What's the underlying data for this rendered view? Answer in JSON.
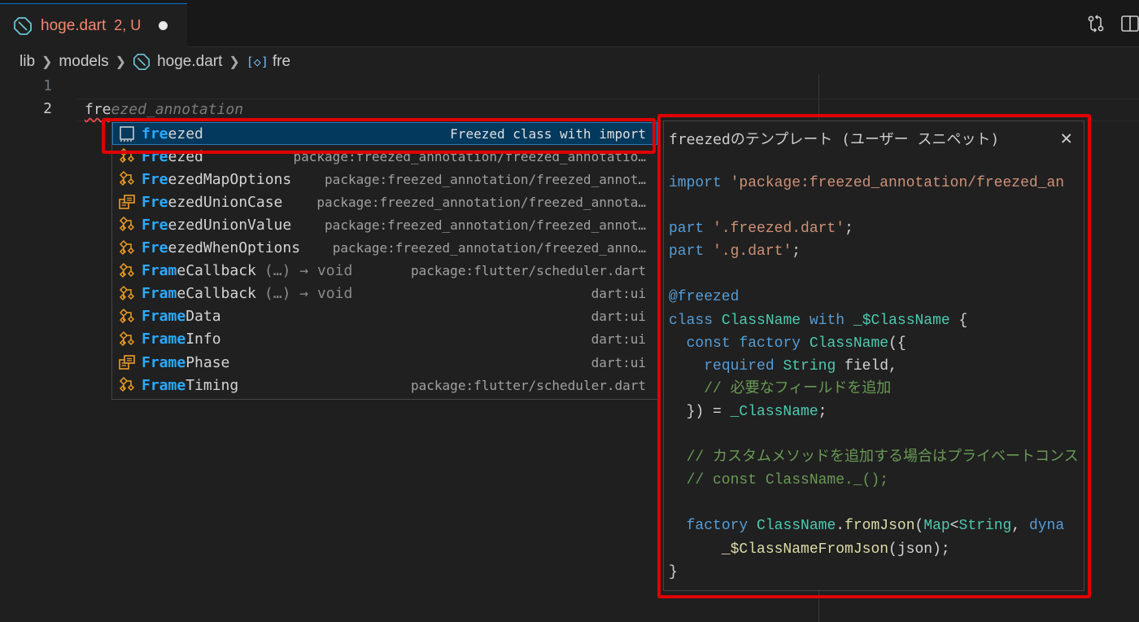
{
  "tab": {
    "file_name": "hoge.dart",
    "status": "2, U"
  },
  "breadcrumb": {
    "folder1": "lib",
    "folder2": "models",
    "file": "hoge.dart",
    "symbol": "fre"
  },
  "editor": {
    "line_numbers": [
      "1",
      "2"
    ],
    "typed_text": "fre",
    "ghost_text": "ezed_annotation"
  },
  "suggestions": [
    {
      "icon": "snippet-icon",
      "match": "fre",
      "rest": "ezed",
      "signature": "",
      "detail": "Freezed class with import",
      "selected": true
    },
    {
      "icon": "class-icon",
      "match": "Fre",
      "rest": "ezed",
      "signature": "",
      "detail": "package:freezed_annotation/freezed_annotatio…"
    },
    {
      "icon": "class-icon",
      "match": "Fre",
      "rest": "ezedMapOptions",
      "signature": "",
      "detail": "package:freezed_annotation/freezed_annot…"
    },
    {
      "icon": "enum-icon",
      "match": "Fre",
      "rest": "ezedUnionCase",
      "signature": "",
      "detail": "package:freezed_annotation/freezed_annota…"
    },
    {
      "icon": "class-icon",
      "match": "Fre",
      "rest": "ezedUnionValue",
      "signature": "",
      "detail": "package:freezed_annotation/freezed_annot…"
    },
    {
      "icon": "class-icon",
      "match": "Fre",
      "rest": "ezedWhenOptions",
      "signature": "",
      "detail": "package:freezed_annotation/freezed_anno…"
    },
    {
      "icon": "class-icon",
      "match": "Fram",
      "rest": "eCallback",
      "signature": "(…) → void",
      "detail": "package:flutter/scheduler.dart"
    },
    {
      "icon": "class-icon",
      "match": "Fram",
      "rest": "eCallback",
      "signature": "(…) → void",
      "detail": "dart:ui"
    },
    {
      "icon": "class-icon",
      "match": "Frame",
      "rest": "Data",
      "signature": "",
      "detail": "dart:ui"
    },
    {
      "icon": "class-icon",
      "match": "Frame",
      "rest": "Info",
      "signature": "",
      "detail": "dart:ui"
    },
    {
      "icon": "enum-icon",
      "match": "Frame",
      "rest": "Phase",
      "signature": "",
      "detail": "dart:ui"
    },
    {
      "icon": "class-icon",
      "match": "Frame",
      "rest": "Timing",
      "signature": "",
      "detail": "package:flutter/scheduler.dart"
    }
  ],
  "details": {
    "title": "freezedのテンプレート (ユーザー スニペット)",
    "code_lines": [
      [
        [
          "kw",
          "import"
        ],
        [
          "pl",
          " "
        ],
        [
          "str",
          "'package:freezed_annotation/freezed_an"
        ]
      ],
      [],
      [
        [
          "kw",
          "part"
        ],
        [
          "pl",
          " "
        ],
        [
          "str",
          "'.freezed.dart'"
        ],
        [
          "pl",
          ";"
        ]
      ],
      [
        [
          "kw",
          "part"
        ],
        [
          "pl",
          " "
        ],
        [
          "str",
          "'.g.dart'"
        ],
        [
          "pl",
          ";"
        ]
      ],
      [],
      [
        [
          "kw",
          "@freezed"
        ]
      ],
      [
        [
          "kw",
          "class"
        ],
        [
          "pl",
          " "
        ],
        [
          "ty",
          "ClassName"
        ],
        [
          "pl",
          " "
        ],
        [
          "kw",
          "with"
        ],
        [
          "pl",
          " "
        ],
        [
          "ty",
          "_$ClassName"
        ],
        [
          "pl",
          " {"
        ]
      ],
      [
        [
          "pl",
          "  "
        ],
        [
          "kw",
          "const"
        ],
        [
          "pl",
          " "
        ],
        [
          "kw",
          "factory"
        ],
        [
          "pl",
          " "
        ],
        [
          "ty",
          "ClassName"
        ],
        [
          "pl",
          "({"
        ]
      ],
      [
        [
          "pl",
          "    "
        ],
        [
          "kw",
          "required"
        ],
        [
          "pl",
          " "
        ],
        [
          "ty",
          "String"
        ],
        [
          "pl",
          " field,"
        ]
      ],
      [
        [
          "cm",
          "    // 必要なフィールドを追加"
        ]
      ],
      [
        [
          "pl",
          "  }) = "
        ],
        [
          "ty",
          "_ClassName"
        ],
        [
          "pl",
          ";"
        ]
      ],
      [],
      [
        [
          "cm",
          "  // カスタムメソッドを追加する場合はプライベートコンス"
        ]
      ],
      [
        [
          "cm",
          "  // const ClassName._();"
        ]
      ],
      [],
      [
        [
          "pl",
          "  "
        ],
        [
          "kw",
          "factory"
        ],
        [
          "pl",
          " "
        ],
        [
          "ty",
          "ClassName"
        ],
        [
          "pl",
          "."
        ],
        [
          "fn",
          "fromJson"
        ],
        [
          "pl",
          "("
        ],
        [
          "ty",
          "Map"
        ],
        [
          "pl",
          "<"
        ],
        [
          "ty",
          "String"
        ],
        [
          "pl",
          ", "
        ],
        [
          "kw",
          "dyna"
        ]
      ],
      [
        [
          "pl",
          "      "
        ],
        [
          "fn",
          "_$ClassNameFromJson"
        ],
        [
          "pl",
          "(json);"
        ]
      ],
      [
        [
          "pl",
          "}"
        ]
      ]
    ]
  }
}
